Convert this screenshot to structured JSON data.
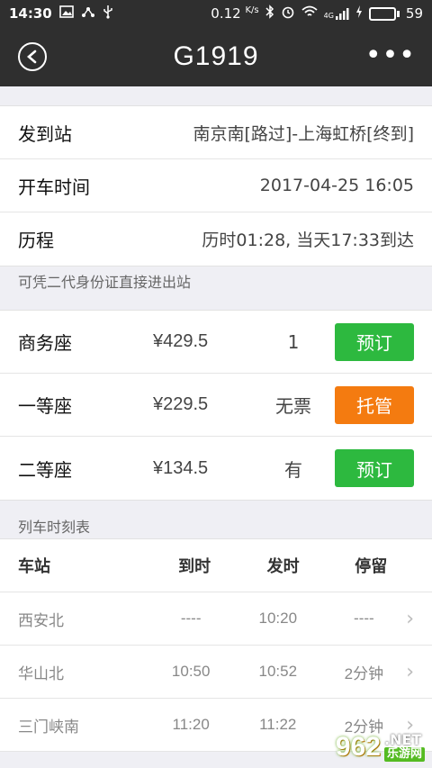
{
  "status_bar": {
    "time": "14:30",
    "speed": "0.12",
    "speed_unit": "K/s",
    "network": "4G",
    "battery": "59",
    "battery_level": 0.59
  },
  "header": {
    "title": "G1919"
  },
  "info": [
    {
      "label": "发到站",
      "value": "南京南[路过]-上海虹桥[终到]"
    },
    {
      "label": "开车时间",
      "value": "2017-04-25 16:05"
    },
    {
      "label": "历程",
      "value": "历时01:28, 当天17:33到达"
    }
  ],
  "id_notice": "可凭二代身份证直接进出站",
  "seats": [
    {
      "name": "商务座",
      "price": "¥429.5",
      "count": "1",
      "action": "预订",
      "color": "#2db93f"
    },
    {
      "name": "一等座",
      "price": "¥229.5",
      "count": "无票",
      "action": "托管",
      "color": "#f47b10"
    },
    {
      "name": "二等座",
      "price": "¥134.5",
      "count": "有",
      "action": "预订",
      "color": "#2db93f"
    }
  ],
  "schedule": {
    "title": "列车时刻表",
    "headers": {
      "station": "车站",
      "arrive": "到时",
      "depart": "发时",
      "stop": "停留"
    },
    "rows": [
      {
        "station": "西安北",
        "arrive": "----",
        "depart": "10:20",
        "stop": "----"
      },
      {
        "station": "华山北",
        "arrive": "10:50",
        "depart": "10:52",
        "stop": "2分钟"
      },
      {
        "station": "三门峡南",
        "arrive": "11:20",
        "depart": "11:22",
        "stop": "2分钟"
      }
    ]
  },
  "watermark": {
    "logo": "962",
    "net": ".NET",
    "cn": "乐游网"
  }
}
